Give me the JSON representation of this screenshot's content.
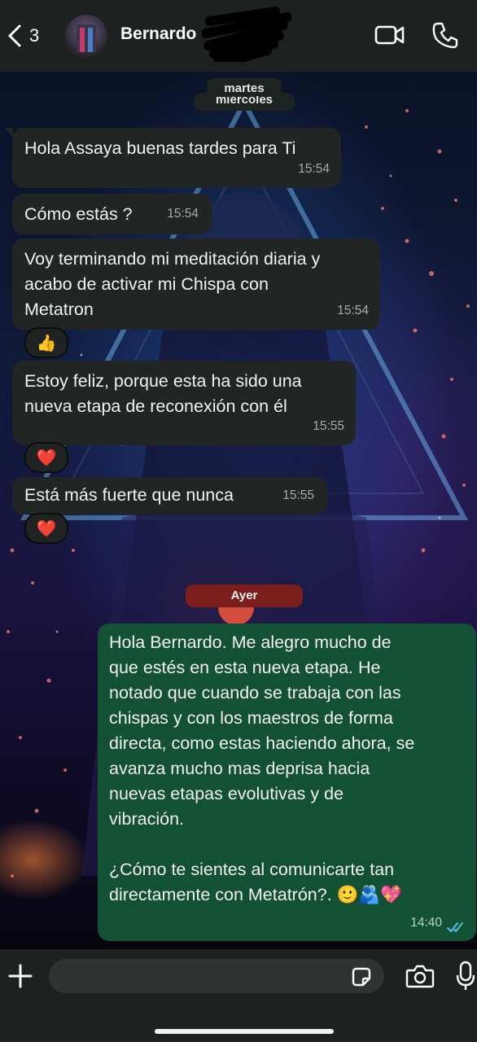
{
  "header": {
    "back_count": "3",
    "contact_name": "Bernardo",
    "icons": [
      "chevron-left-icon",
      "video-call-icon",
      "phone-icon"
    ]
  },
  "day_labels": {
    "first_top": "martes",
    "first_under": "miércoles",
    "second": "Ayer"
  },
  "messages": [
    {
      "dir": "in",
      "text": "Hola Assaya buenas tardes para Ti",
      "time": "15:54"
    },
    {
      "dir": "in",
      "text": "Cómo estás ?",
      "time": "15:54"
    },
    {
      "dir": "in",
      "lines": [
        "Voy terminando mi meditación diaria y",
        "acabo de activar mi Chispa con",
        "Metatron"
      ],
      "time": "15:54",
      "reaction": "👍"
    },
    {
      "dir": "in",
      "lines": [
        "Estoy feliz, porque esta ha sido una",
        "nueva etapa de reconexión con él"
      ],
      "time": "15:55",
      "reaction": "❤️"
    },
    {
      "dir": "in",
      "text": "Está más fuerte que nunca",
      "time": "15:55",
      "reaction": "❤️"
    },
    {
      "dir": "out",
      "lines": [
        "Hola Bernardo. Me alegro mucho de",
        "que estés en esta nueva etapa. He",
        "notado que cuando se trabaja con las",
        "chispas y con los maestros de forma",
        "directa, como estas haciendo ahora, se",
        "avanza mucho mas deprisa hacia",
        "nuevas etapas evolutivas y de",
        "vibración.",
        "",
        "¿Cómo te sientes al comunicarte tan",
        "directamente con Metatrón?. 🙂🫂💖"
      ],
      "time": "14:40",
      "status": "read"
    }
  ],
  "input": {
    "placeholder": "",
    "icons": [
      "plus-icon",
      "sticker-icon",
      "camera-icon",
      "microphone-icon"
    ]
  },
  "colors": {
    "incoming_bubble": "#212524",
    "outgoing_bubble": "#135134",
    "header_bg": "#1d2220",
    "read_ticks": "#53bdeb",
    "today_pill": "#7b1e1c"
  }
}
